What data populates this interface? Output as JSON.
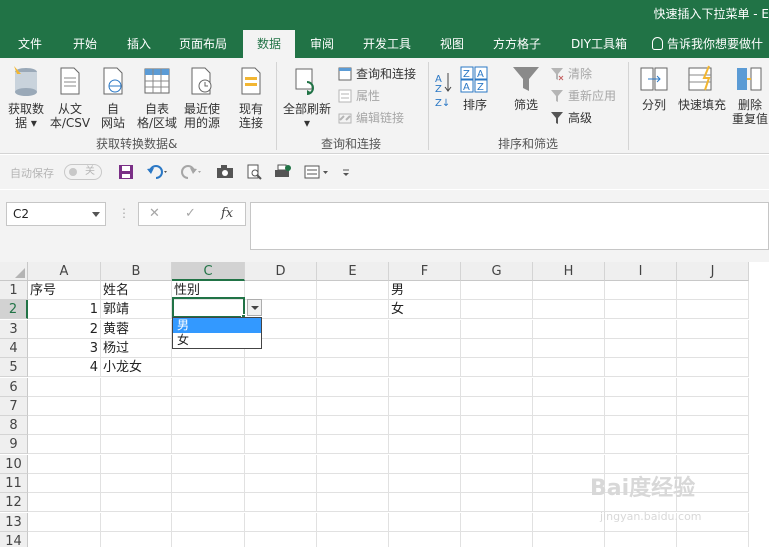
{
  "window": {
    "title": "快速插入下拉菜单  -  E"
  },
  "tabs": [
    {
      "label": "文件"
    },
    {
      "label": "开始"
    },
    {
      "label": "插入"
    },
    {
      "label": "页面布局"
    },
    {
      "label": "数据"
    },
    {
      "label": "审阅"
    },
    {
      "label": "开发工具"
    },
    {
      "label": "视图"
    },
    {
      "label": "方方格子"
    },
    {
      "label": "DIY工具箱"
    }
  ],
  "active_tab": "数据",
  "tellme": {
    "label": "告诉我你想要做什"
  },
  "ribbon": {
    "group1": {
      "label": "获取转换数据&",
      "buttons": [
        {
          "line1": "获取数",
          "line2": "据 ▾"
        },
        {
          "line1": "从文",
          "line2": "本/CSV"
        },
        {
          "line1": "自",
          "line2": "网站"
        },
        {
          "line1": "自表",
          "line2": "格/区域"
        },
        {
          "line1": "最近使",
          "line2": "用的源"
        },
        {
          "line1": "现有",
          "line2": "连接"
        }
      ]
    },
    "group2": {
      "label": "查询和连接",
      "refresh": {
        "line1": "全部刷新",
        "line2": "▾"
      },
      "queries": "查询和连接",
      "properties": "属性",
      "edit_links": "编辑链接"
    },
    "group3": {
      "label": "排序和筛选",
      "sort": "排序",
      "filter": "筛选",
      "clear": "清除",
      "reapply": "重新应用",
      "advanced": "高级"
    },
    "group4": {
      "split": "分列",
      "flash_fill": "快速填充",
      "remove_dup": {
        "line1": "删除",
        "line2": "重复值"
      }
    }
  },
  "qat": {
    "autosave": "自动保存",
    "toggle": "关"
  },
  "formula_bar": {
    "name_box": "C2",
    "cancel": "✕",
    "enter": "✓",
    "fx": "fx",
    "value": ""
  },
  "sheet": {
    "columns": [
      "A",
      "B",
      "C",
      "D",
      "E",
      "F",
      "G",
      "H",
      "I",
      "J"
    ],
    "rows": [
      "1",
      "2",
      "3",
      "4",
      "5",
      "6",
      "7",
      "8",
      "9",
      "10",
      "11",
      "12",
      "13",
      "14"
    ],
    "cells": {
      "A1": "序号",
      "B1": "姓名",
      "C1": "性别",
      "A2": "1",
      "B2": "郭靖",
      "A3": "2",
      "B3": "黄蓉",
      "A4": "3",
      "B4": "杨过",
      "A5": "4",
      "B5": "小龙女",
      "F1": "男",
      "F2": "女"
    },
    "active_cell": "C2",
    "dropdown_options": [
      "男",
      "女"
    ],
    "dropdown_highlighted": "男"
  },
  "watermark": {
    "main": "Bai度经验",
    "sub": "jingyan.baidu.com"
  },
  "colors": {
    "accent": "#217346",
    "highlight": "#3399ff"
  }
}
